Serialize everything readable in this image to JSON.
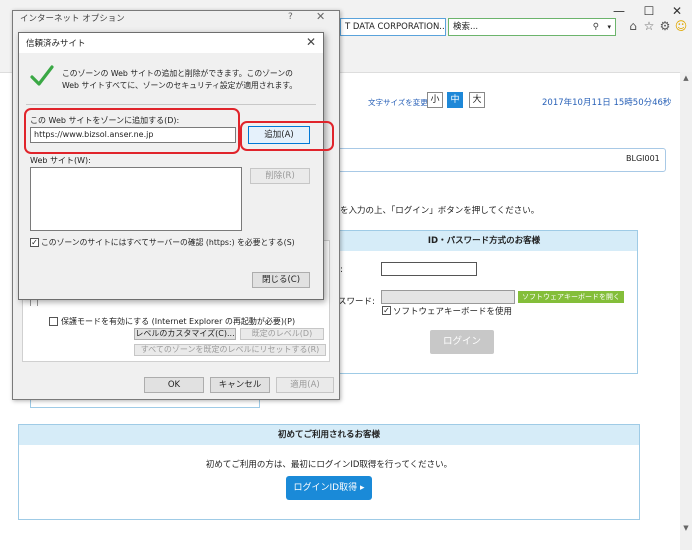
{
  "browser": {
    "address_text": "T DATA CORPORATION... ↺",
    "search_placeholder": "検索...",
    "window_controls": [
      "—",
      "☐",
      "✕"
    ],
    "toolbar_icons": [
      "home-icon",
      "star-icon",
      "gear-icon",
      "smiley-icon"
    ]
  },
  "page": {
    "text_size_label": "文字サイズを変更",
    "text_sizes": [
      "小",
      "中",
      "大"
    ],
    "active_text_size": "中",
    "datetime": "2017年10月11日 15時50分46秒",
    "screen_code": "BLGI001",
    "instruction": "を入力の上、「ログイン」ボタンを押してください。",
    "id_section": {
      "header": "ID・パスワード方式のお客様",
      "id_label": ":",
      "password_label": "スワード:",
      "software_keyboard_button": "ソフトウェアキーボードを開く",
      "software_keyboard_checkbox": "ソフトウェアキーボードを使用",
      "login_button": "ログイン"
    },
    "first_time": {
      "header": "初めてご利用されるお客様",
      "message": "初めてご利用の方は、最初にログインID取得を行ってください。",
      "button": "ログインID取得 ▸"
    }
  },
  "internet_options": {
    "title": "インターネット オプション",
    "help": "?",
    "close": "✕",
    "protected_mode_label": "保護モードを有効にする (Internet Explorer の再起動が必要)(P)",
    "custom_level_button": "レベルのカスタマイズ(C)...",
    "default_level_button": "既定のレベル(D)",
    "reset_all_button": "すべてのゾーンを既定のレベルにリセットする(R)",
    "ok_button": "OK",
    "cancel_button": "キャンセル",
    "apply_button": "適用(A)"
  },
  "trusted_sites": {
    "title": "信頼済みサイト",
    "close": "✕",
    "description": "このゾーンの Web サイトの追加と削除ができます。このゾーンの Web サイトすべてに、ゾーンのセキュリティ設定が適用されます。",
    "add_label": "この Web サイトをゾーンに追加する(D):",
    "url_value": "https://www.bizsol.anser.ne.jp",
    "add_button": "追加(A)",
    "websites_label": "Web サイト(W):",
    "remove_button": "削除(R)",
    "https_checkbox_label": "このゾーンのサイトにはすべてサーバーの確認 (https:) を必要とする(S)",
    "close_button": "閉じる(C)",
    "checkmark_color": "#3aa845"
  },
  "highlight_color": "#e0242b"
}
